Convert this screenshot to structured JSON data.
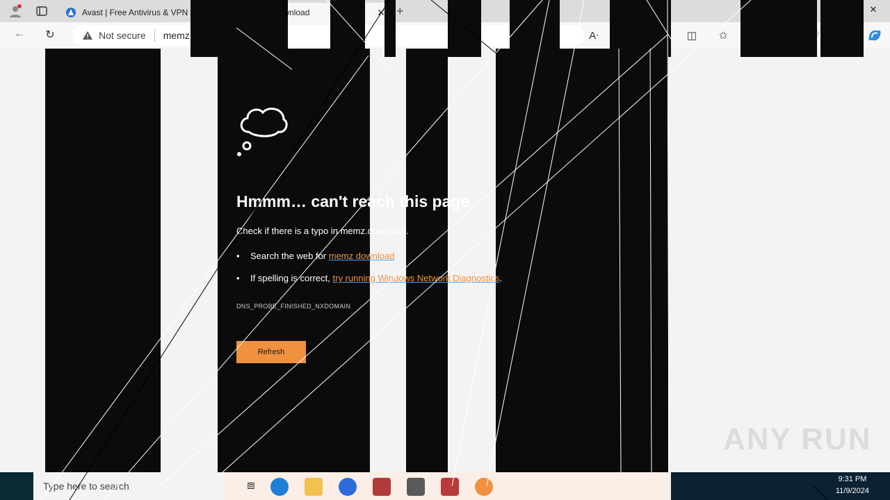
{
  "tabs": [
    {
      "title": "Avast | Free Antivirus & VPN Dow",
      "active": false
    },
    {
      "title": "memz.download",
      "active": true
    }
  ],
  "address": {
    "security": "Not secure",
    "url": "memz.download"
  },
  "error_page": {
    "title": "Hmmm… can't reach this page",
    "subtitle": "Check if there is a typo in memz.download.",
    "bullet1_prefix": "Search the web for ",
    "bullet1_link": "memz download",
    "bullet2_prefix": "If spelling is correct, ",
    "bullet2_link": "try running Windows Network Diagnostics",
    "bullet2_suffix": ".",
    "error_code": "DNS_PROBE_FINISHED_NXDOMAIN",
    "refresh_label": "Refresh"
  },
  "taskbar": {
    "search_placeholder": "Type here to search",
    "time": "9:31 PM",
    "date": "11/9/2024"
  },
  "watermark": "ANY RUN",
  "colors": {
    "accent": "#f0913f",
    "link_underline": "#4aa3ff",
    "stripes": "#0b0b0b"
  }
}
